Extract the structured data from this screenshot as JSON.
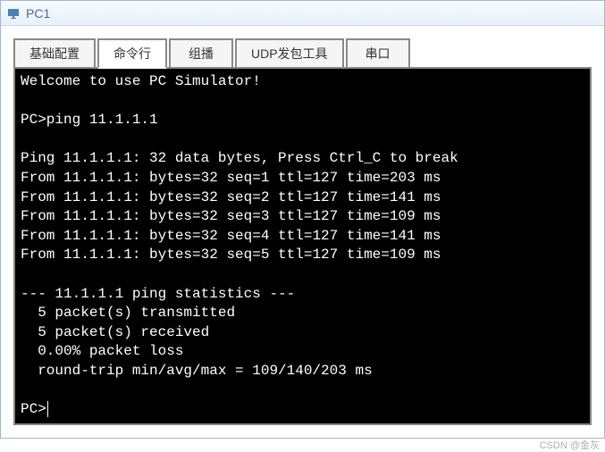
{
  "window": {
    "title": "PC1"
  },
  "tabs": {
    "items": [
      {
        "label": "基础配置"
      },
      {
        "label": "命令行"
      },
      {
        "label": "组播"
      },
      {
        "label": "UDP发包工具"
      },
      {
        "label": "串口"
      }
    ],
    "active_index": 1
  },
  "terminal": {
    "lines": [
      "Welcome to use PC Simulator!",
      "",
      "PC>ping 11.1.1.1",
      "",
      "Ping 11.1.1.1: 32 data bytes, Press Ctrl_C to break",
      "From 11.1.1.1: bytes=32 seq=1 ttl=127 time=203 ms",
      "From 11.1.1.1: bytes=32 seq=2 ttl=127 time=141 ms",
      "From 11.1.1.1: bytes=32 seq=3 ttl=127 time=109 ms",
      "From 11.1.1.1: bytes=32 seq=4 ttl=127 time=141 ms",
      "From 11.1.1.1: bytes=32 seq=5 ttl=127 time=109 ms",
      "",
      "--- 11.1.1.1 ping statistics ---",
      "  5 packet(s) transmitted",
      "  5 packet(s) received",
      "  0.00% packet loss",
      "  round-trip min/avg/max = 109/140/203 ms",
      ""
    ],
    "prompt": "PC>"
  },
  "watermark": "CSDN @金灰"
}
